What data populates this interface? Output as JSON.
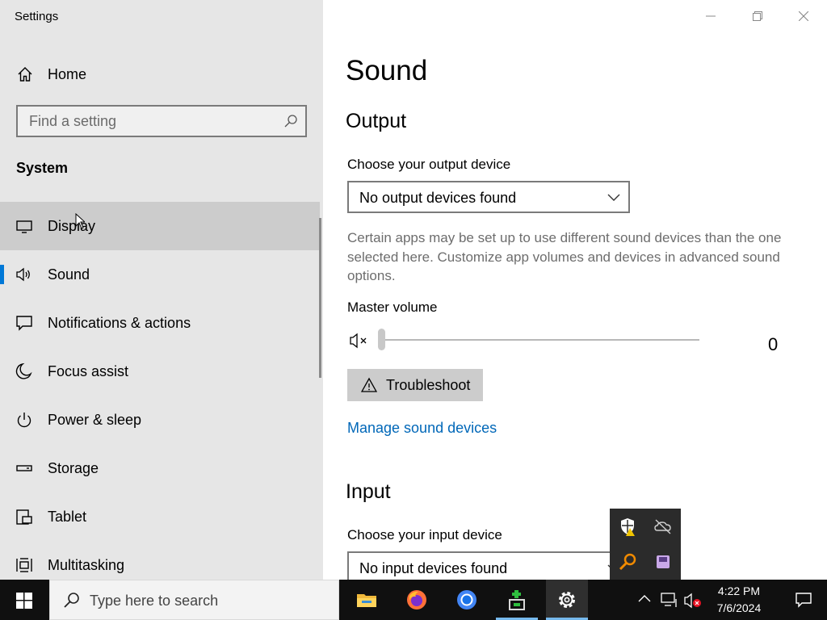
{
  "window": {
    "title": "Settings"
  },
  "sidebar": {
    "home_label": "Home",
    "search_placeholder": "Find a setting",
    "group_title": "System",
    "items": [
      {
        "label": "Display",
        "icon": "monitor-icon"
      },
      {
        "label": "Sound",
        "icon": "speaker-icon",
        "selected": true
      },
      {
        "label": "Notifications & actions",
        "icon": "notification-icon"
      },
      {
        "label": "Focus assist",
        "icon": "moon-icon"
      },
      {
        "label": "Power & sleep",
        "icon": "power-icon"
      },
      {
        "label": "Storage",
        "icon": "storage-icon"
      },
      {
        "label": "Tablet",
        "icon": "tablet-icon"
      },
      {
        "label": "Multitasking",
        "icon": "multitasking-icon"
      }
    ]
  },
  "main": {
    "page_title": "Sound",
    "output": {
      "section_title": "Output",
      "device_label": "Choose your output device",
      "device_value": "No output devices found",
      "description": "Certain apps may be set up to use different sound devices than the one selected here. Customize app volumes and devices in advanced sound options.",
      "volume_label": "Master volume",
      "volume_value": "0",
      "troubleshoot_label": "Troubleshoot",
      "manage_link": "Manage sound devices"
    },
    "input": {
      "section_title": "Input",
      "device_label": "Choose your input device",
      "device_value": "No input devices found"
    }
  },
  "taskbar": {
    "search_placeholder": "Type here to search",
    "apps": [
      "file-explorer-icon",
      "firefox-icon",
      "chrome-icon",
      "installer-icon",
      "settings-gear-icon"
    ],
    "clock_time": "4:22 PM",
    "clock_date": "7/6/2024"
  },
  "colors": {
    "accent": "#0078d7",
    "link": "#0067b8",
    "taskbar": "#101010",
    "sidebar": "#e6e6e6"
  }
}
